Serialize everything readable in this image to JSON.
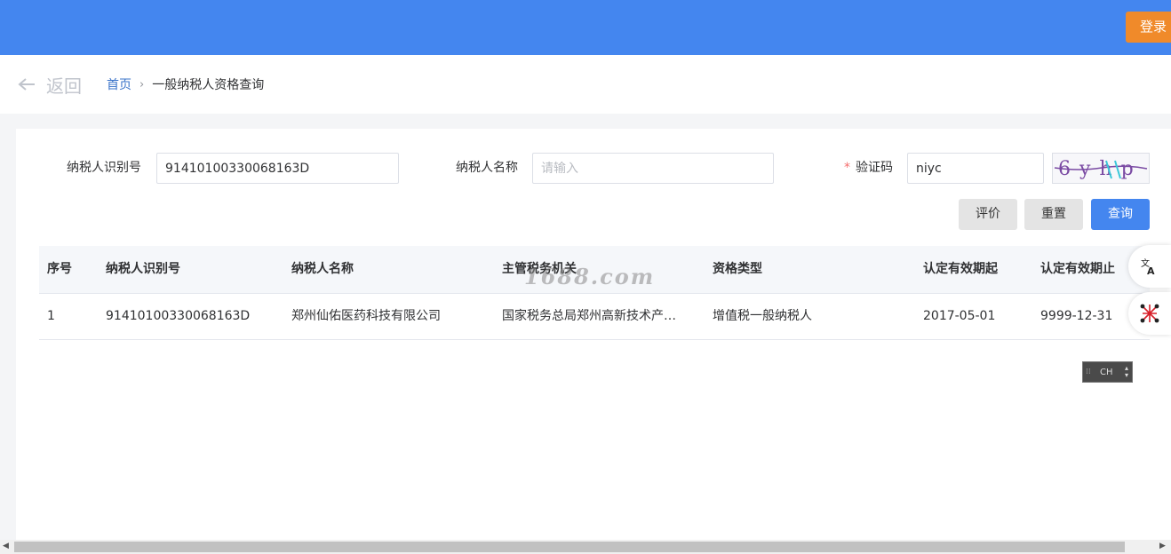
{
  "header": {
    "login_label": "登录"
  },
  "nav": {
    "back_label": "返回",
    "breadcrumb": {
      "home": "首页",
      "separator": "›",
      "current": "一般纳税人资格查询"
    }
  },
  "form": {
    "taxpayer_id": {
      "label": "纳税人识别号",
      "value": "91410100330068163D"
    },
    "taxpayer_name": {
      "label": "纳税人名称",
      "value": "",
      "placeholder": "请输入"
    },
    "captcha": {
      "required_mark": "*",
      "label": "验证码",
      "value": "niyc",
      "image_text": "6yhp"
    },
    "buttons": {
      "rate": "评价",
      "reset": "重置",
      "query": "查询"
    }
  },
  "table": {
    "columns": [
      "序号",
      "纳税人识别号",
      "纳税人名称",
      "主管税务机关",
      "资格类型",
      "认定有效期起",
      "认定有效期止"
    ],
    "rows": [
      {
        "index": "1",
        "taxpayer_id": "91410100330068163D",
        "name": "郑州仙佑医药科技有限公司",
        "authority": "国家税务总局郑州高新技术产…",
        "qualification": "增值税一般纳税人",
        "valid_from": "2017-05-01",
        "valid_to": "9999-12-31"
      }
    ]
  },
  "watermark": "1688.com",
  "ime": {
    "label": "CH"
  },
  "colors": {
    "primary": "#4486ef",
    "login": "#f08a2a",
    "required": "#f56c6c"
  }
}
